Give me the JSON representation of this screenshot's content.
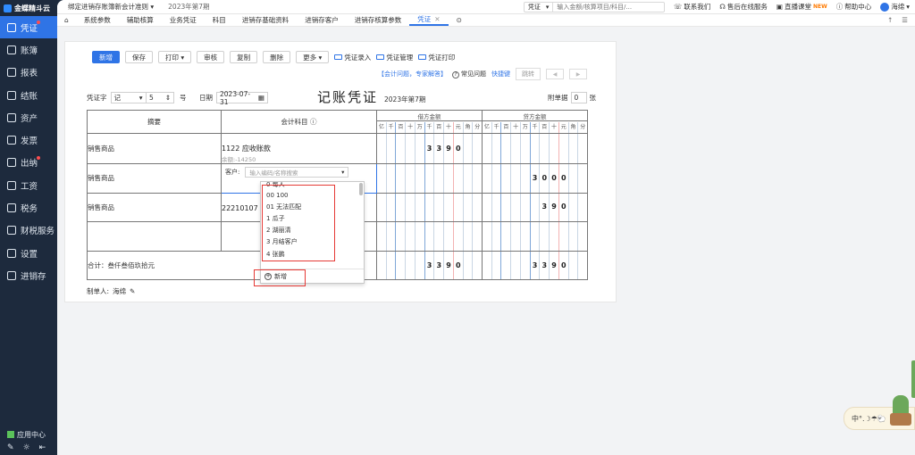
{
  "sidebar": {
    "logo": "金蝶精斗云",
    "items": [
      {
        "label": "凭证",
        "active": true,
        "dot": true
      },
      {
        "label": "账簿"
      },
      {
        "label": "报表"
      },
      {
        "label": "结账"
      },
      {
        "label": "资产"
      },
      {
        "label": "发票"
      },
      {
        "label": "出纳",
        "dot": true
      },
      {
        "label": "工资"
      },
      {
        "label": "税务"
      },
      {
        "label": "财税服务"
      },
      {
        "label": "设置"
      },
      {
        "label": "进销存"
      }
    ],
    "app_center": "应用中心"
  },
  "topbar": {
    "company": "绑定进销存账簿新会计准则",
    "period": "2023年第7期",
    "search_type": "凭证",
    "search_placeholder": "输入金额/核算项目/科目/...",
    "contact_us": "联系我们",
    "online_service": "售后在线服务",
    "live_class": "直播课堂",
    "new_badge": "NEW",
    "help": "帮助中心",
    "user": "海绵"
  },
  "tabs": [
    {
      "label": "系统参数"
    },
    {
      "label": "辅助核算"
    },
    {
      "label": "业务凭证"
    },
    {
      "label": "科目"
    },
    {
      "label": "进销存基础资料"
    },
    {
      "label": "进销存客户"
    },
    {
      "label": "进销存核算参数"
    },
    {
      "label": "凭证",
      "active": true
    }
  ],
  "toolbar": {
    "new": "新增",
    "save": "保存",
    "print": "打印",
    "audit": "审核",
    "copy": "复制",
    "delete": "删除",
    "more": "更多",
    "voucher_entry": "凭证录入",
    "voucher_manage": "凭证管理",
    "voucher_print": "凭证打印"
  },
  "help_row": {
    "expert": "【会计问题，专家解答】",
    "faq": "常见问题",
    "shortcut": "快捷键",
    "jump": "跳转"
  },
  "voucher": {
    "word_label": "凭证字",
    "word_value": "记",
    "number_value": "5",
    "number_label": "号",
    "date_label": "日期",
    "date_value": "2023-07-31",
    "title": "记账凭证",
    "period": "2023年第7期",
    "attach_label": "附单据",
    "attach_value": "0",
    "attach_unit": "张",
    "col_summary": "摘要",
    "col_account": "会计科目",
    "col_debit": "借方金额",
    "col_credit": "贷方金额",
    "digit_units": [
      "亿",
      "千",
      "百",
      "十",
      "万",
      "千",
      "百",
      "十",
      "元",
      "角",
      "分"
    ],
    "rows": [
      {
        "summary": "销售商品",
        "account": "1122 应收账款",
        "balance": "余额:-14250",
        "debit": "3390",
        "credit": ""
      },
      {
        "summary": "销售商品",
        "account": "",
        "balance": "",
        "debit": "",
        "credit": "3000"
      },
      {
        "summary": "销售商品",
        "account": "22210107 应",
        "balance": "",
        "debit": "",
        "credit": "390"
      },
      {
        "summary": "",
        "account": "",
        "balance": "",
        "debit": "",
        "credit": ""
      }
    ],
    "aux_label": "客户:",
    "aux_placeholder": "输入编码/名称搜索",
    "total_label": "合计：叁仟叁佰玖拾元",
    "total_debit": "3390",
    "total_credit": "3390",
    "maker_label": "制单人:",
    "maker_name": "海绵"
  },
  "dropdown": {
    "items": [
      "0 每人",
      "00 100",
      "01 无法匹配",
      "1 瓜子",
      "2 湖丽清",
      "3 月结客户",
      "4 张鹏"
    ],
    "add_label": "新增"
  },
  "mascot": "中°.☽☂︎🐑",
  "colors": {
    "accent": "#2f74e6",
    "sidebar": "#1d2a3d",
    "annotation": "#e53935"
  }
}
